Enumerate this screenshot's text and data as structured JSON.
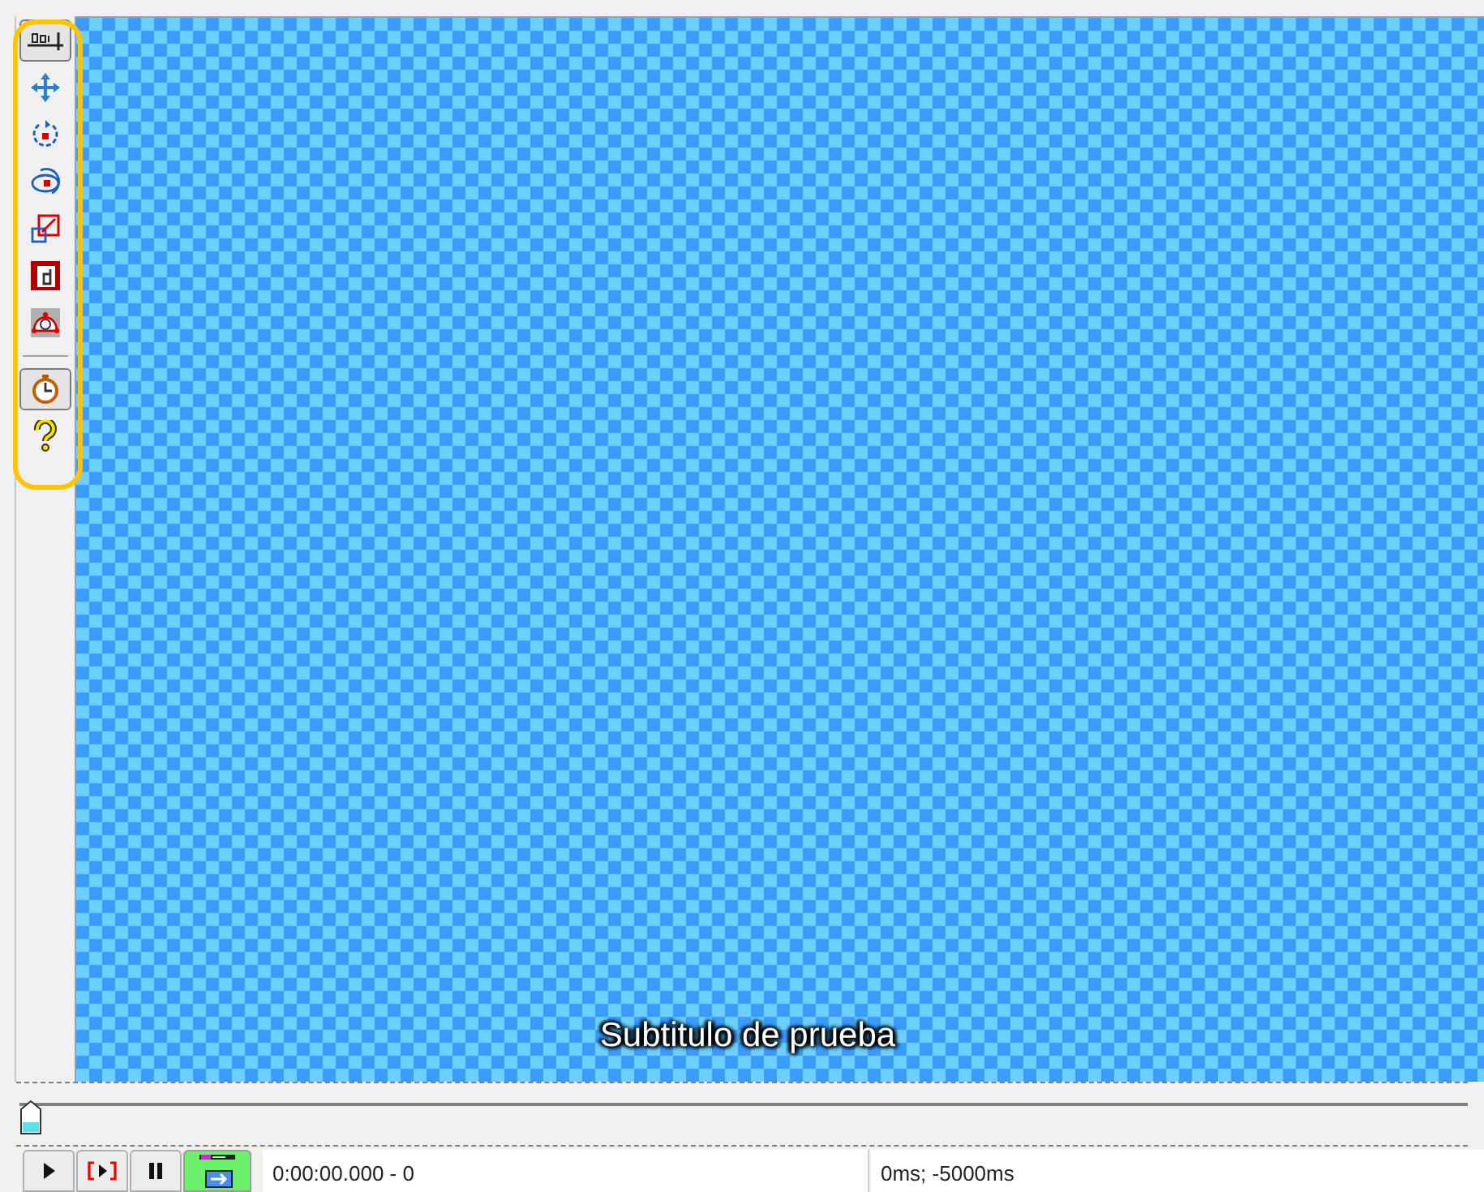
{
  "tools": [
    {
      "kind": "ruler",
      "selected": true
    },
    {
      "kind": "move",
      "selected": false
    },
    {
      "kind": "rotate",
      "selected": false
    },
    {
      "kind": "rotate3d",
      "selected": false
    },
    {
      "kind": "scale",
      "selected": false
    },
    {
      "kind": "clip",
      "selected": false
    },
    {
      "kind": "vector",
      "selected": false
    },
    {
      "kind": "separator"
    },
    {
      "kind": "clock",
      "selected": true
    },
    {
      "kind": "help",
      "selected": false
    }
  ],
  "subtitle": "Subtitulo de prueba",
  "seek": {
    "level": 0
  },
  "controls": [
    {
      "kind": "play",
      "selected": false
    },
    {
      "kind": "play-range",
      "selected": false
    },
    {
      "kind": "pause",
      "selected": false
    },
    {
      "kind": "autoscroll",
      "selected": true
    }
  ],
  "time": "0:00:00.000 - 0",
  "offset": "0ms; -5000ms"
}
